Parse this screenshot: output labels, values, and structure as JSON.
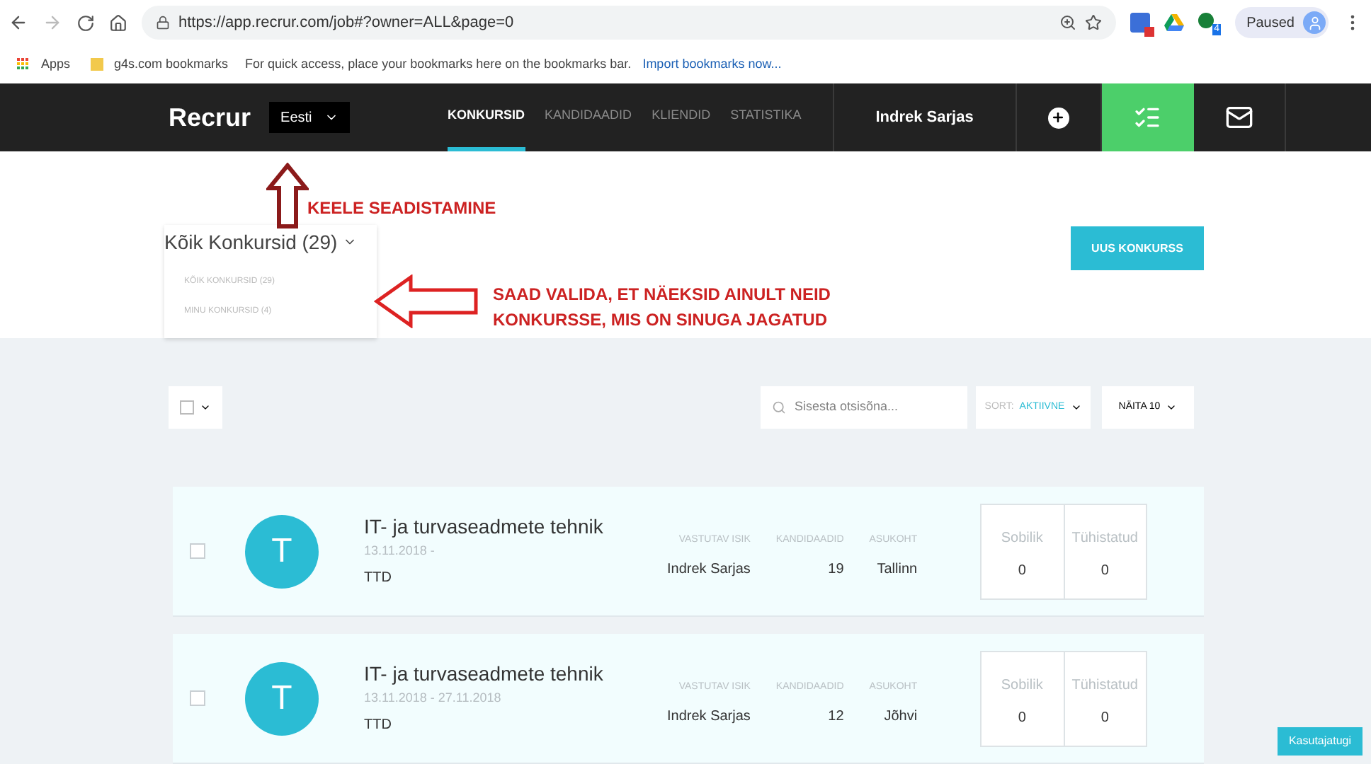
{
  "browser": {
    "url": "https://app.recrur.com/job#?owner=ALL&page=0",
    "extension_badge": "4",
    "profile": "Paused"
  },
  "bookmarks_bar": {
    "apps": "Apps",
    "folder": "g4s.com bookmarks",
    "hint": "For quick access, place your bookmarks here on the bookmarks bar.",
    "import_link": "Import bookmarks now..."
  },
  "nav": {
    "logo": "Recrur",
    "language": "Eesti",
    "tabs": [
      {
        "label": "KONKURSID",
        "selected": true
      },
      {
        "label": "KANDIDAADID",
        "selected": false
      },
      {
        "label": "KLIENDID",
        "selected": false
      },
      {
        "label": "STATISTIKA",
        "selected": false
      }
    ],
    "user": "Indrek Sarjas"
  },
  "annotations": [
    {
      "text": "KEELE SEADISTAMINE"
    },
    {
      "text": "SAAD VALIDA, ET NÄEKSID AINULT NEID KONKURSSE, MIS ON SINUGA JAGATUD"
    }
  ],
  "filter": {
    "title": "Kõik Konkursid (29)",
    "options": [
      "KÕIK KONKURSID (29)",
      "MINU KONKURSID (4)"
    ]
  },
  "new_button": "UUS KONKURSS",
  "toolbar": {
    "search_placeholder": "Sisesta otsisõna...",
    "sort_label": "SORT:",
    "sort_value": "AKTIIVNE",
    "show": "NÄITA 10"
  },
  "jobs": [
    {
      "checked": false,
      "avatar": "T",
      "title": "IT- ja turvaseadmete tehnik",
      "dates": "13.11.2018 -",
      "company": "TTD",
      "columns": [
        {
          "label": "VASTUTAV ISIK",
          "value": "Indrek Sarjas"
        },
        {
          "label": "KANDIDAADID",
          "value": "19"
        },
        {
          "label": "ASUKOHT",
          "value": "Tallinn"
        }
      ],
      "stats": [
        {
          "label": "Sobilik",
          "value": "0"
        },
        {
          "label": "Tühistatud",
          "value": "0"
        }
      ]
    },
    {
      "checked": false,
      "avatar": "T",
      "title": "IT- ja turvaseadmete tehnik",
      "dates": "13.11.2018 - 27.11.2018",
      "company": "TTD",
      "columns": [
        {
          "label": "VASTUTAV ISIK",
          "value": "Indrek Sarjas"
        },
        {
          "label": "KANDIDAADID",
          "value": "12"
        },
        {
          "label": "ASUKOHT",
          "value": "Jõhvi"
        }
      ],
      "stats": [
        {
          "label": "Sobilik",
          "value": "0"
        },
        {
          "label": "Tühistatud",
          "value": "0"
        }
      ]
    }
  ],
  "help_button": "Kasutajatugi"
}
